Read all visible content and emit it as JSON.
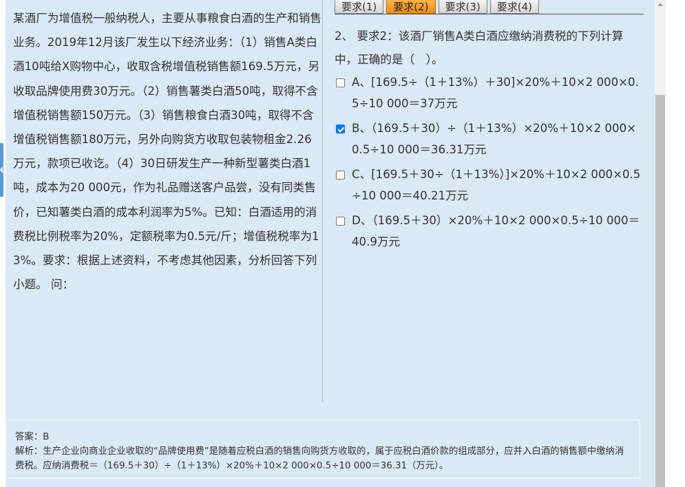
{
  "material": {
    "text": "某酒厂为增值税一般纳税人，主要从事粮食白酒的生产和销售业务。2019年12月该厂发生以下经济业务：（1）销售A类白酒10吨给X购物中心，收取含税增值税销售额169.5万元，另收取品牌使用费30万元。（2）销售薯类白酒50吨，取得不含增值税销售额150万元。（3）销售粮食白酒30吨，取得不含增值税销售额180万元，另外向购货方收取包装物租金2.26万元，款项已收讫。（4）30日研发生产一种新型薯类白酒1吨，成本为20 000元，作为礼品赠送客户品尝，没有同类售价，已知薯类白酒的成本利润率为5%。已知：白酒适用的消费税比例税率为20%，定额税率为0.5元/斤；增值税税率为13%。要求：根据上述资料，不考虑其他因素，分析回答下列小题。 问："
  },
  "tabs": [
    {
      "label": "要求(1)",
      "active": false
    },
    {
      "label": "要求(2)",
      "active": true
    },
    {
      "label": "要求(3)",
      "active": false
    },
    {
      "label": "要求(4)",
      "active": false
    }
  ],
  "question": {
    "text": "2、 要求2：该酒厂销售A类白酒应缴纳消费税的下列计算中，正确的是（　）。"
  },
  "options": [
    {
      "text": "A、[169.5÷（1＋13%）＋30]×20%＋10×2 000×0.5÷10 000＝37万元",
      "checked": false
    },
    {
      "text": "B、（169.5＋30）÷（1＋13%）×20%＋10×2 000×0.5÷10 000＝36.31万元",
      "checked": true
    },
    {
      "text": "C、[169.5＋30÷（1＋13%）]×20%＋10×2 000×0.5÷10 000＝40.21万元",
      "checked": false
    },
    {
      "text": "D、（169.5＋30）×20%＋10×2 000×0.5÷10 000＝40.9万元",
      "checked": false
    }
  ],
  "answer": {
    "line1": "答案：B",
    "line2": "解析：生产企业向商业企业收取的“品牌使用费”是随着应税白酒的销售向购货方收取的，属于应税白酒价款的组成部分，应并入白酒的销售额中缴纳消费税。应纳消费税＝（169.5＋30）÷（1＋13%）×20%＋10×2 000×0.5÷10 000＝36.31（万元）。"
  },
  "colors": {
    "panel_bg": "#dbe8f6",
    "active_tab": "#f08c14",
    "checkbox_checked": "#0075ff",
    "left_tab": "#5b9bd5"
  },
  "icons": {
    "left_tab": "chevron-left-icon",
    "checked": "checkmark-icon",
    "scroll_up": "arrow-up-icon"
  }
}
